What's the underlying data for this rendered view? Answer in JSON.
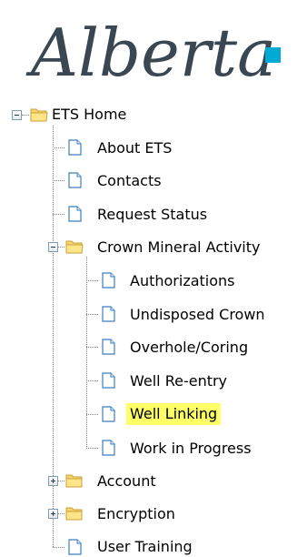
{
  "logo": {
    "text": "Alberta"
  },
  "colors": {
    "logo_text": "#3a4652",
    "logo_square": "#00aad2",
    "highlight": "#ffff66",
    "folder": "#f6d36b",
    "page_icon": "#3c7fc1"
  },
  "tree": {
    "root_label": "ETS Home",
    "items": {
      "about_ets": "About ETS",
      "contacts": "Contacts",
      "request_status": "Request Status",
      "crown_mineral_activity": "Crown Mineral Activity",
      "authorizations": "Authorizations",
      "undisposed_crown": "Undisposed Crown",
      "overhole_coring": "Overhole/Coring",
      "well_reentry": "Well Re-entry",
      "well_linking": "Well Linking",
      "work_in_progress": "Work in Progress",
      "account": "Account",
      "encryption": "Encryption",
      "user_training": "User Training"
    },
    "selected": "Well Linking"
  }
}
